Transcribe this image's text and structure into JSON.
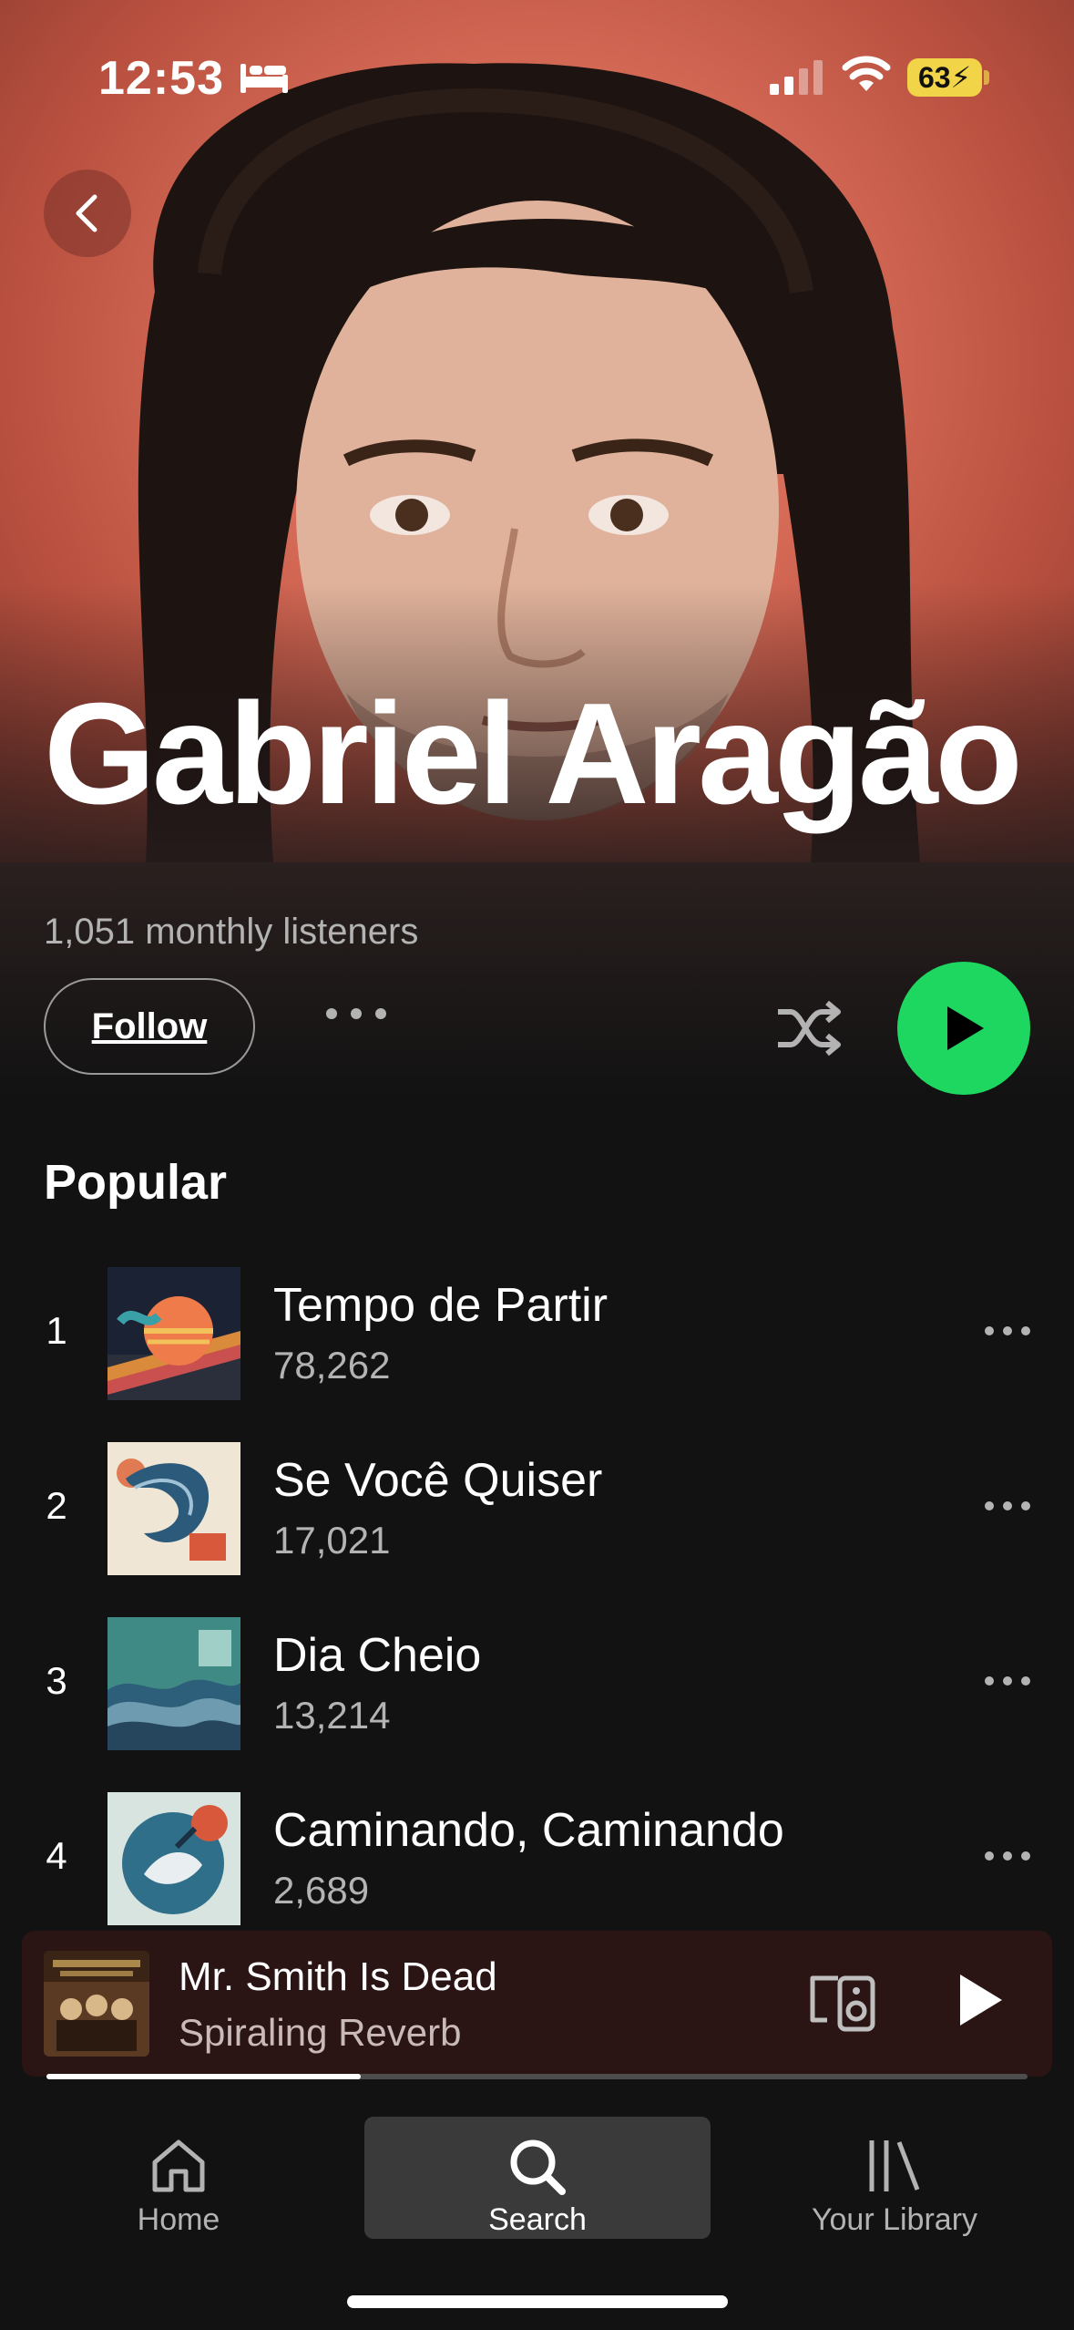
{
  "status_bar": {
    "time": "12:53",
    "battery": "63",
    "icons": [
      "bed-icon",
      "signal-icon",
      "wifi-icon",
      "battery-charging-icon"
    ]
  },
  "colors": {
    "accent_green": "#1ed760",
    "hero_background": "#d96e5a",
    "now_playing_background": "#2a1414",
    "battery_yellow": "#f1d447"
  },
  "artist": {
    "name": "Gabriel Aragão",
    "monthly_listeners": "1,051 monthly listeners",
    "follow_label": "Follow"
  },
  "popular": {
    "title": "Popular",
    "tracks": [
      {
        "rank": "1",
        "title": "Tempo de Partir",
        "plays": "78,262"
      },
      {
        "rank": "2",
        "title": "Se Você Quiser",
        "plays": "17,021"
      },
      {
        "rank": "3",
        "title": "Dia Cheio",
        "plays": "13,214"
      },
      {
        "rank": "4",
        "title": "Caminando, Caminando",
        "plays": "2,689"
      }
    ]
  },
  "now_playing": {
    "title": "Mr. Smith Is Dead",
    "artist": "Spiraling Reverb",
    "progress": 0.32
  },
  "tabs": [
    {
      "label": "Home",
      "icon": "home-icon",
      "active": false
    },
    {
      "label": "Search",
      "icon": "search-icon",
      "active": true
    },
    {
      "label": "Your Library",
      "icon": "library-icon",
      "active": false
    }
  ]
}
